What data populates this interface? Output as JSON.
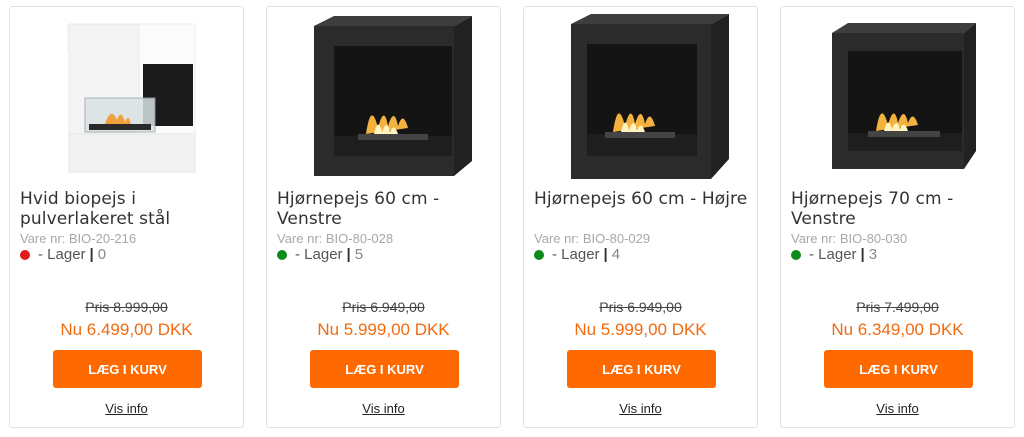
{
  "colors": {
    "accent": "#ff6a00",
    "price_new": "#f26a10",
    "stock_out": "#e51b1b",
    "stock_in": "#0f8a1c"
  },
  "products": [
    {
      "title": "Hvid biopejs i pulverlakeret stål",
      "sku": "Vare nr: BIO-20-216",
      "stock_label": "- Lager",
      "stock_sep": "|",
      "stock_count": "0",
      "stock_status": "out",
      "old_price": "Pris 8.999,00",
      "new_price": "Nu 6.499,00 DKK",
      "button_label": "LÆG I KURV",
      "info_label": "Vis info"
    },
    {
      "title": "Hjørnepejs 60 cm - Venstre",
      "sku": "Vare nr: BIO-80-028",
      "stock_label": "- Lager",
      "stock_sep": "|",
      "stock_count": "5",
      "stock_status": "in",
      "old_price": "Pris 6.949,00",
      "new_price": "Nu 5.999,00 DKK",
      "button_label": "LÆG I KURV",
      "info_label": "Vis info"
    },
    {
      "title": "Hjørnepejs 60 cm - Højre",
      "sku": "Vare nr: BIO-80-029",
      "stock_label": "- Lager",
      "stock_sep": "|",
      "stock_count": "4",
      "stock_status": "in",
      "old_price": "Pris 6.949,00",
      "new_price": "Nu 5.999,00 DKK",
      "button_label": "LÆG I KURV",
      "info_label": "Vis info"
    },
    {
      "title": "Hjørnepejs 70 cm - Venstre",
      "sku": "Vare nr: BIO-80-030",
      "stock_label": "- Lager",
      "stock_sep": "|",
      "stock_count": "3",
      "stock_status": "in",
      "old_price": "Pris 7.499,00",
      "new_price": "Nu 6.349,00 DKK",
      "button_label": "LÆG I KURV",
      "info_label": "Vis info"
    }
  ]
}
